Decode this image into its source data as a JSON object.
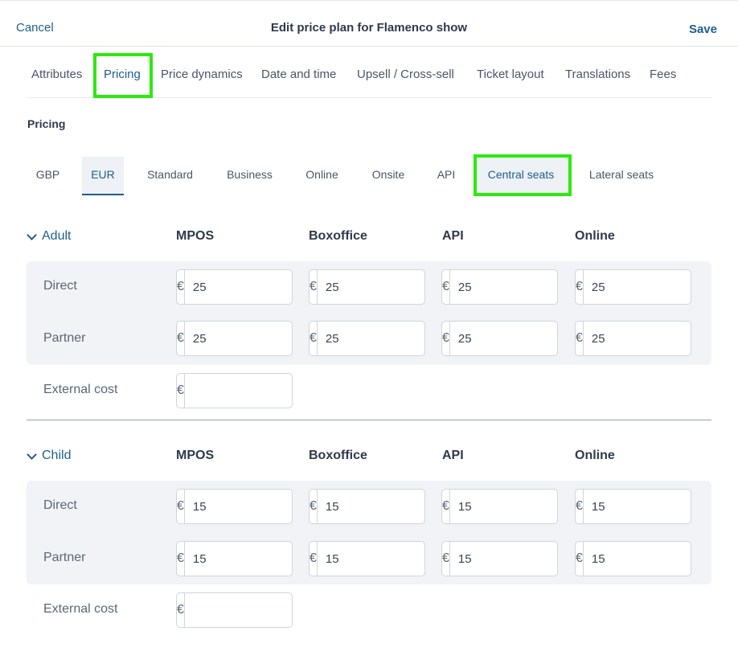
{
  "header": {
    "cancel": "Cancel",
    "title": "Edit price plan for Flamenco show",
    "save": "Save"
  },
  "tabs": [
    {
      "label": "Attributes"
    },
    {
      "label": "Pricing"
    },
    {
      "label": "Price dynamics"
    },
    {
      "label": "Date and time"
    },
    {
      "label": "Upsell / Cross-sell"
    },
    {
      "label": "Ticket layout"
    },
    {
      "label": "Translations"
    },
    {
      "label": "Fees"
    }
  ],
  "section_title": "Pricing",
  "subtabs": [
    {
      "label": "GBP"
    },
    {
      "label": "EUR"
    },
    {
      "label": "Standard"
    },
    {
      "label": "Business"
    },
    {
      "label": "Online"
    },
    {
      "label": "Onsite"
    },
    {
      "label": "API"
    },
    {
      "label": "Central seats"
    },
    {
      "label": "Lateral seats"
    }
  ],
  "columns": [
    "MPOS",
    "Boxoffice",
    "API",
    "Online"
  ],
  "currency_symbol": "€",
  "groups": [
    {
      "name": "Adult",
      "rows": [
        {
          "label": "Direct",
          "values": [
            "25",
            "25",
            "25",
            "25"
          ]
        },
        {
          "label": "Partner",
          "values": [
            "25",
            "25",
            "25",
            "25"
          ]
        }
      ],
      "external_cost": {
        "label": "External cost",
        "value": ""
      }
    },
    {
      "name": "Child",
      "rows": [
        {
          "label": "Direct",
          "values": [
            "15",
            "15",
            "15",
            "15"
          ]
        },
        {
          "label": "Partner",
          "values": [
            "15",
            "15",
            "15",
            "15"
          ]
        }
      ],
      "external_cost": {
        "label": "External cost",
        "value": ""
      }
    }
  ],
  "colors": {
    "accent": "#1f5e8c",
    "highlight": "#2ee80e",
    "band": "#f1f3f6"
  }
}
